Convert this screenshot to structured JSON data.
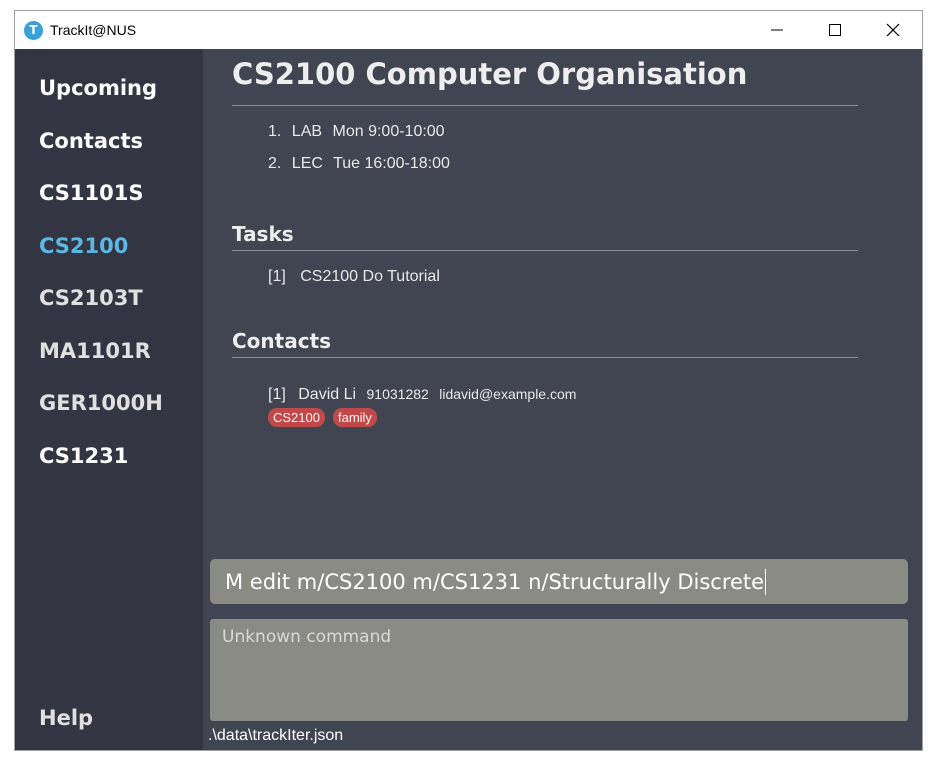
{
  "window": {
    "title": "TrackIt@NUS",
    "app_icon_letter": "T"
  },
  "sidebar": {
    "items": [
      {
        "label": "Upcoming"
      },
      {
        "label": "Contacts"
      },
      {
        "label": "CS1101S"
      },
      {
        "label": "CS2100",
        "active": true
      },
      {
        "label": "CS2103T"
      },
      {
        "label": "MA1101R"
      },
      {
        "label": "GER1000H"
      },
      {
        "label": "CS1231"
      }
    ],
    "help_label": "Help"
  },
  "module": {
    "title": "CS2100 Computer Organisation",
    "lessons": [
      {
        "index": "1.",
        "type": "LAB",
        "time": "Mon 9:00-10:00"
      },
      {
        "index": "2.",
        "type": "LEC",
        "time": "Tue 16:00-18:00"
      }
    ],
    "tasks_heading": "Tasks",
    "tasks": [
      {
        "index": "[1]",
        "text": "CS2100 Do Tutorial"
      }
    ],
    "contacts_heading": "Contacts",
    "contacts": [
      {
        "index": "[1]",
        "name": "David Li",
        "phone": "91031282",
        "email": "lidavid@example.com",
        "tags": [
          "CS2100",
          "family"
        ]
      }
    ]
  },
  "command": {
    "value": "M edit m/CS2100 m/CS1231 n/Structurally Discrete"
  },
  "result": {
    "text": "Unknown command"
  },
  "status_bar": {
    "path": ".\\data\\trackIter.json"
  },
  "colors": {
    "sidebar_bg": "#333642",
    "main_bg": "#414552",
    "active_nav": "#5bb7e3",
    "tag_bg": "#c24949",
    "input_bg": "#8a8b85"
  }
}
